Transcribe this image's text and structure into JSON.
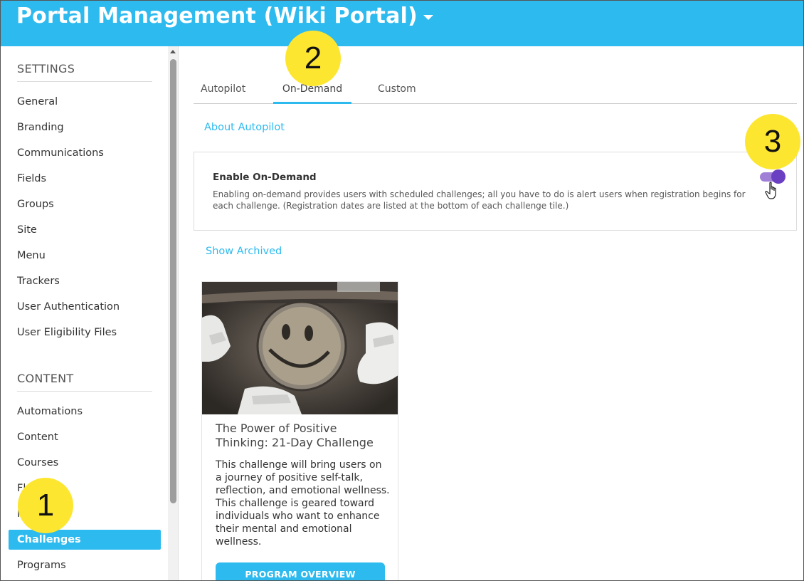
{
  "header": {
    "title": "Portal Management (Wiki Portal)"
  },
  "sidebar": {
    "settings_title": "SETTINGS",
    "settings_items": [
      {
        "label": "General"
      },
      {
        "label": "Branding"
      },
      {
        "label": "Communications"
      },
      {
        "label": "Fields"
      },
      {
        "label": "Groups"
      },
      {
        "label": "Site"
      },
      {
        "label": "Menu"
      },
      {
        "label": "Trackers"
      },
      {
        "label": "User Authentication"
      },
      {
        "label": "User Eligibility Files"
      }
    ],
    "content_title": "CONTENT",
    "content_items": [
      {
        "label": "Automations"
      },
      {
        "label": "Content"
      },
      {
        "label": "Courses"
      },
      {
        "label": "Fl"
      },
      {
        "label": "P          er"
      },
      {
        "label": "Challenges",
        "active": true
      },
      {
        "label": "Programs"
      }
    ]
  },
  "tabs": [
    {
      "label": "Autopilot"
    },
    {
      "label": "On-Demand",
      "active": true
    },
    {
      "label": "Custom"
    }
  ],
  "links": {
    "about": "About Autopilot",
    "archived": "Show Archived"
  },
  "ondemand_card": {
    "title": "Enable On-Demand",
    "description": "Enabling on-demand provides users with scheduled challenges; all you have to do is alert users when registration begins for each challenge. (Registration dates are listed at the bottom of each challenge tile.)",
    "toggle_on": true
  },
  "challenge_tile": {
    "title": "The Power of Positive Thinking: 21-Day Challenge",
    "description": "This challenge will bring users on a journey of positive self-talk, reflection, and emotional wellness. This challenge is geared toward individuals who want to enhance their mental and emotional wellness.",
    "button_label": "PROGRAM OVERVIEW"
  },
  "callouts": {
    "one": "1",
    "two": "2",
    "three": "3"
  },
  "colors": {
    "brand": "#2dbaef",
    "toggle_track": "#a07fd6",
    "toggle_knob": "#6a3fc2",
    "callout": "#fde630"
  }
}
